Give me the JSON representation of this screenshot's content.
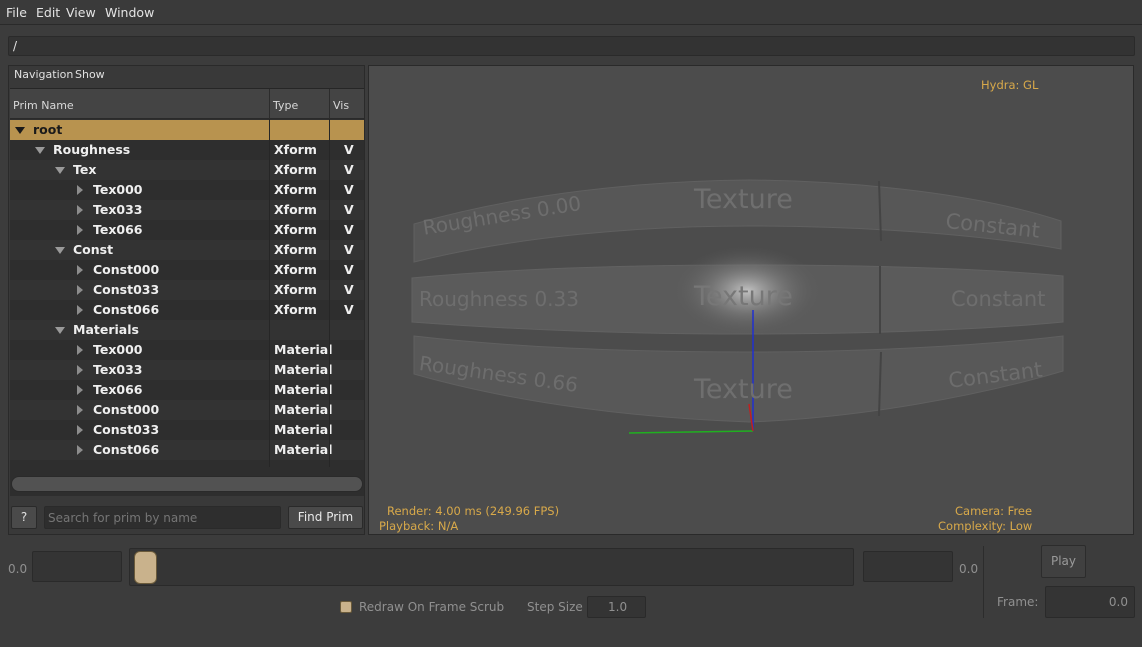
{
  "menu": [
    "File",
    "Edit",
    "View",
    "Window"
  ],
  "path": "/",
  "left_panel": {
    "tabs": [
      "Navigation",
      "Show"
    ],
    "columns": [
      "Prim Name",
      "Type",
      "Vis"
    ],
    "rows": [
      {
        "name": "root",
        "type": "",
        "vis": "",
        "expanded": true,
        "depth": 0
      },
      {
        "name": "Roughness",
        "type": "Xform",
        "vis": "V",
        "expanded": true,
        "depth": 1
      },
      {
        "name": "Tex",
        "type": "Xform",
        "vis": "V",
        "expanded": true,
        "depth": 2
      },
      {
        "name": "Tex000",
        "type": "Xform",
        "vis": "V",
        "expanded": false,
        "depth": 3
      },
      {
        "name": "Tex033",
        "type": "Xform",
        "vis": "V",
        "expanded": false,
        "depth": 3
      },
      {
        "name": "Tex066",
        "type": "Xform",
        "vis": "V",
        "expanded": false,
        "depth": 3
      },
      {
        "name": "Const",
        "type": "Xform",
        "vis": "V",
        "expanded": true,
        "depth": 2
      },
      {
        "name": "Const000",
        "type": "Xform",
        "vis": "V",
        "expanded": false,
        "depth": 3
      },
      {
        "name": "Const033",
        "type": "Xform",
        "vis": "V",
        "expanded": false,
        "depth": 3
      },
      {
        "name": "Const066",
        "type": "Xform",
        "vis": "V",
        "expanded": false,
        "depth": 3
      },
      {
        "name": "Materials",
        "type": "",
        "vis": "",
        "expanded": true,
        "depth": 2
      },
      {
        "name": "Tex000",
        "type": "Material",
        "vis": "",
        "expanded": false,
        "depth": 3
      },
      {
        "name": "Tex033",
        "type": "Material",
        "vis": "",
        "expanded": false,
        "depth": 3
      },
      {
        "name": "Tex066",
        "type": "Material",
        "vis": "",
        "expanded": false,
        "depth": 3
      },
      {
        "name": "Const000",
        "type": "Material",
        "vis": "",
        "expanded": false,
        "depth": 3
      },
      {
        "name": "Const033",
        "type": "Material",
        "vis": "",
        "expanded": false,
        "depth": 3
      },
      {
        "name": "Const066",
        "type": "Material",
        "vis": "",
        "expanded": false,
        "depth": 3
      }
    ],
    "help_label": "?",
    "search_placeholder": "Search for prim by name",
    "find_label": "Find Prim"
  },
  "viewport": {
    "renderer": "Hydra: GL",
    "render_stats": "Render: 4.00 ms (249.96 FPS)",
    "playback": "Playback: N/A",
    "camera": "Camera: Free",
    "complexity": "Complexity: Low",
    "scene_labels": {
      "row1": [
        "Roughness 0.00",
        "Texture",
        "Constant"
      ],
      "row2": [
        "Roughness 0.33",
        "Texture",
        "Constant"
      ],
      "row3": [
        "Roughness 0.66",
        "Texture",
        "Constant"
      ]
    }
  },
  "timeline": {
    "start_value": "0.0",
    "end_value": "0.0",
    "redraw_label": "Redraw On Frame Scrub",
    "redraw_checked": true,
    "step_size_label": "Step Size",
    "step_size_value": "1.0",
    "play_label": "Play",
    "frame_label": "Frame:",
    "frame_value": "0.0"
  },
  "colors": {
    "selection": "#b8934f",
    "overlay_text": "#d8a94a",
    "accent_handle": "#c9b28c"
  }
}
